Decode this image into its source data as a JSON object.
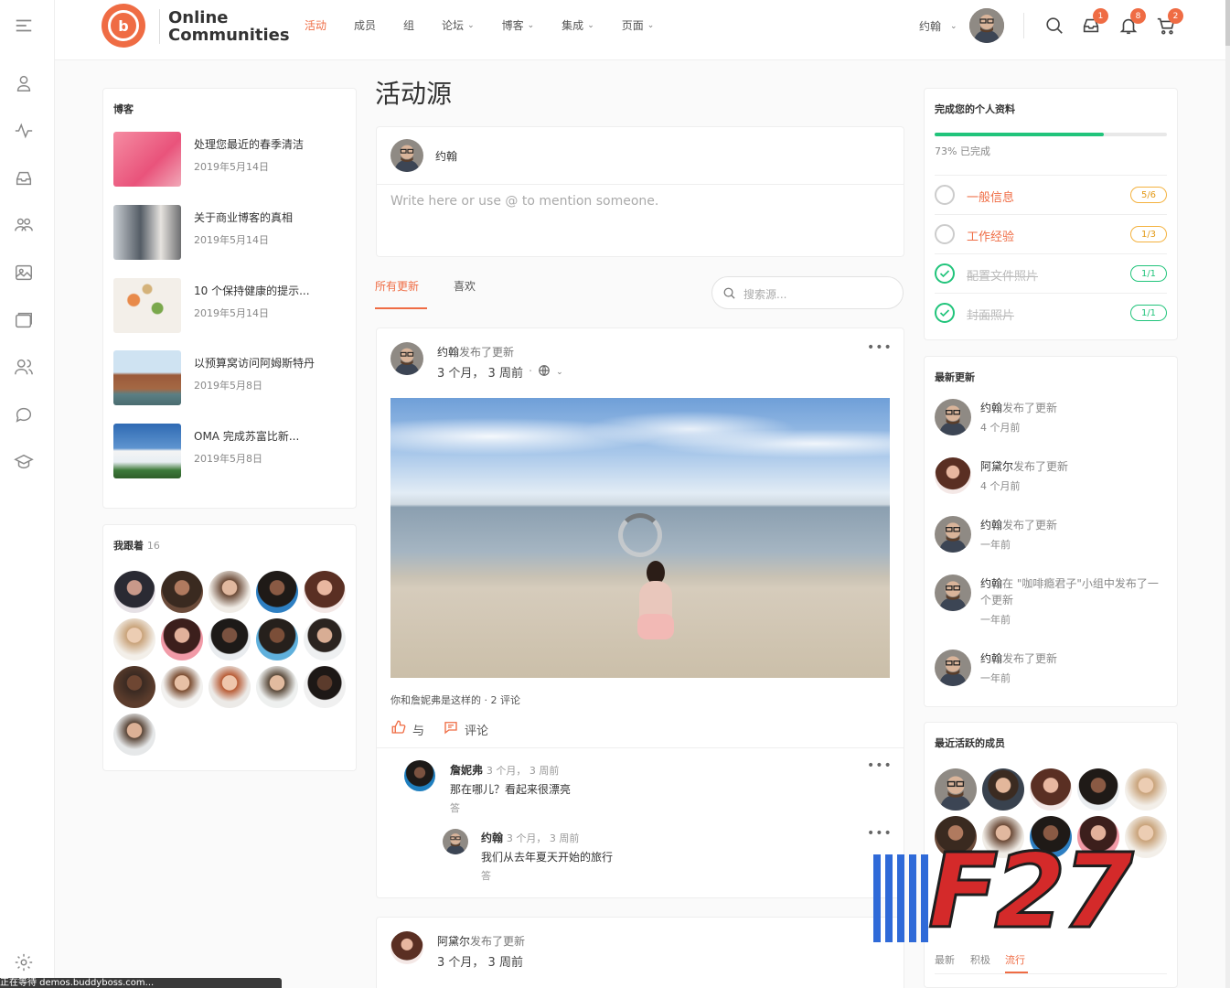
{
  "brand": {
    "line1": "Online",
    "line2": "Communities"
  },
  "nav": [
    {
      "label": "活动",
      "active": true,
      "has_caret": false
    },
    {
      "label": "成员",
      "active": false,
      "has_caret": false
    },
    {
      "label": "组",
      "active": false,
      "has_caret": false
    },
    {
      "label": "论坛",
      "active": false,
      "has_caret": true
    },
    {
      "label": "博客",
      "active": false,
      "has_caret": true
    },
    {
      "label": "集成",
      "active": false,
      "has_caret": true
    },
    {
      "label": "页面",
      "active": false,
      "has_caret": true
    }
  ],
  "user": {
    "name": "约翰"
  },
  "badges": {
    "inbox": "1",
    "notifications": "8",
    "cart": "2"
  },
  "blogs": {
    "title": "博客",
    "items": [
      {
        "title": "处理您最近的春季清洁",
        "date": "2019年5月14日"
      },
      {
        "title": "关于商业博客的真相",
        "date": "2019年5月14日"
      },
      {
        "title": "10 个保持健康的提示...",
        "date": "2019年5月14日"
      },
      {
        "title": "以预算窝访问阿姆斯特丹",
        "date": "2019年5月8日"
      },
      {
        "title": "OMA 完成苏富比新...",
        "date": "2019年5月8日"
      }
    ]
  },
  "following": {
    "title": "我跟着",
    "count": "16"
  },
  "page_title": "活动源",
  "composer": {
    "name": "约翰",
    "placeholder": "Write here or use @ to mention someone."
  },
  "tabs": {
    "all": "所有更新",
    "likes": "喜欢"
  },
  "search": {
    "placeholder": "搜索源..."
  },
  "post1": {
    "author": "约翰",
    "action": "发布了更新",
    "time": "3 个月， 3 周前",
    "separator": "·",
    "meta": "你和詹妮弗是这样的 · 2 评论",
    "like": "与",
    "comment": "评论",
    "comments": [
      {
        "name": "詹妮弗",
        "time": "3 个月， 3 周前",
        "text": "那在哪儿？看起来很漂亮",
        "reply": "答"
      },
      {
        "name": "约翰",
        "time": "3 个月， 3 周前",
        "text": "我们从去年夏天开始的旅行",
        "reply": "答"
      }
    ]
  },
  "post2": {
    "author": "阿黛尔",
    "action": "发布了更新",
    "time": "3 个月， 3 周前"
  },
  "profile": {
    "title": "完成您的个人资料",
    "progress_percent": 73,
    "progress_text": "73% 已完成",
    "items": [
      {
        "label": "一般信息",
        "value": "5/6",
        "done": false
      },
      {
        "label": "工作经验",
        "value": "1/3",
        "done": false
      },
      {
        "label": "配置文件照片",
        "value": "1/1",
        "done": true
      },
      {
        "label": "封面照片",
        "value": "1/1",
        "done": true
      }
    ]
  },
  "recent": {
    "title": "最新更新",
    "items": [
      {
        "name": "约翰",
        "action": "发布了更新",
        "time": "4 个月前"
      },
      {
        "name": "阿黛尔",
        "action": "发布了更新",
        "time": "4 个月前"
      },
      {
        "name": "约翰",
        "action": "发布了更新",
        "time": "一年前"
      },
      {
        "name": "约翰",
        "action": "在  \"咖啡瘾君子\"小组中发布了一个更新",
        "time": "一年前"
      },
      {
        "name": "约翰",
        "action": "发布了更新",
        "time": "一年前"
      }
    ]
  },
  "active_members": {
    "title": "最近活跃的成员"
  },
  "groups_tabs": {
    "newest": "最新",
    "active": "积极",
    "popular": "流行"
  },
  "status_bar": "正在等待 demos.buddyboss.com...",
  "watermark": "F27",
  "colors": {
    "accent": "#ef6c44",
    "success": "#21c47b",
    "warning": "#f4b23f"
  }
}
